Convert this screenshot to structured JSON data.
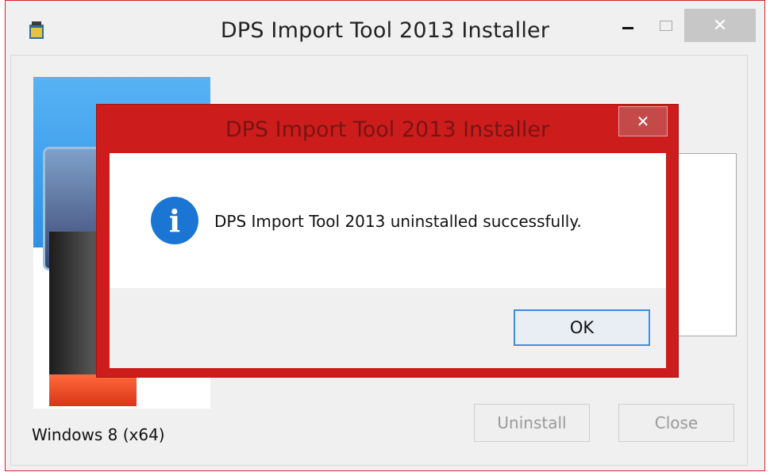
{
  "main_window": {
    "title": "DPS Import Tool 2013 Installer",
    "minimize_icon": "minimize-icon",
    "maximize_icon": "maximize-icon",
    "close_glyph": "✕",
    "os_label": "Windows 8 (x64)",
    "uninstall_label": "Uninstall",
    "close_label": "Close"
  },
  "dialog": {
    "title": "DPS Import Tool 2013 Installer",
    "close_glyph": "✕",
    "icon": "info-icon",
    "icon_glyph": "i",
    "message": "DPS Import Tool 2013 uninstalled successfully.",
    "ok_label": "OK"
  },
  "colors": {
    "dialog_frame": "#cc1c1c",
    "info_icon": "#1a76d2",
    "ok_focus": "#3c8ee3"
  }
}
